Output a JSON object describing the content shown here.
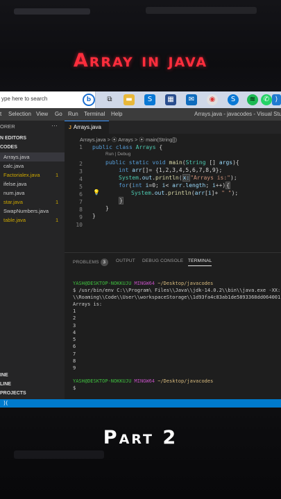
{
  "headline": "Array in java",
  "footer_caption": "Part 2",
  "taskbar": {
    "search_placeholder": "ype here to search",
    "icons": [
      "cortana-icon",
      "task-view-icon",
      "file-explorer-icon",
      "skype-icon",
      "store-icon",
      "mail-icon",
      "chrome-icon",
      "skype-icon",
      "spotify-icon",
      "whatsapp-icon",
      "vscode-icon"
    ]
  },
  "menubar": {
    "items": [
      "t",
      "Selection",
      "View",
      "Go",
      "Run",
      "Terminal",
      "Help"
    ],
    "window_title": "Arrays.java - javacodes - Visual Studio C"
  },
  "sidebar": {
    "header": "ORER",
    "sections": {
      "open_editors": "N EDITORS",
      "folder": "CODES"
    },
    "files": [
      {
        "name": "Arrays.java",
        "badge": ""
      },
      {
        "name": "calc.java",
        "badge": ""
      },
      {
        "name": "Factorialex.java",
        "badge": "1"
      },
      {
        "name": "ifelse.java",
        "badge": ""
      },
      {
        "name": "num.java",
        "badge": ""
      },
      {
        "name": "star.java",
        "badge": "1"
      },
      {
        "name": "SwapNumbers.java",
        "badge": ""
      },
      {
        "name": "table.java",
        "badge": "1"
      }
    ],
    "bottom": [
      "INE",
      "LINE",
      "PROJECTS"
    ]
  },
  "editor": {
    "tab": "Arrays.java",
    "breadcrumb": "Arrays.java > ⦿ Arrays > ⦿ main(String[])",
    "codelens": "Run | Debug",
    "line_numbers": [
      "1",
      "2",
      "3",
      "4",
      "5",
      "6",
      "7",
      "8",
      "9",
      "10"
    ]
  },
  "panel": {
    "tabs": [
      "PROBLEMS",
      "OUTPUT",
      "DEBUG CONSOLE",
      "TERMINAL"
    ],
    "problems_count": "3",
    "prompt_user": "YASH@DESKTOP-NOKKUJU",
    "prompt_env": "MINGW64",
    "prompt_path": "~/Desktop/javacodes",
    "command": "$ /usr/bin/env C:\\\\Program\\ Files\\\\Java\\\\jdk-14.0.2\\\\bin\\\\java.exe -XX:",
    "command_cont": "\\\\Roaming\\\\Code\\\\User\\\\workspaceStorage\\\\1d93fa4c83ab1de5893368dd064001",
    "output_header": "Arrays is:",
    "output_values": [
      "1",
      "2",
      "3",
      "4",
      "5",
      "6",
      "7",
      "8",
      "9"
    ],
    "final_prompt": "$"
  },
  "statusbar_icon": "remote-icon"
}
